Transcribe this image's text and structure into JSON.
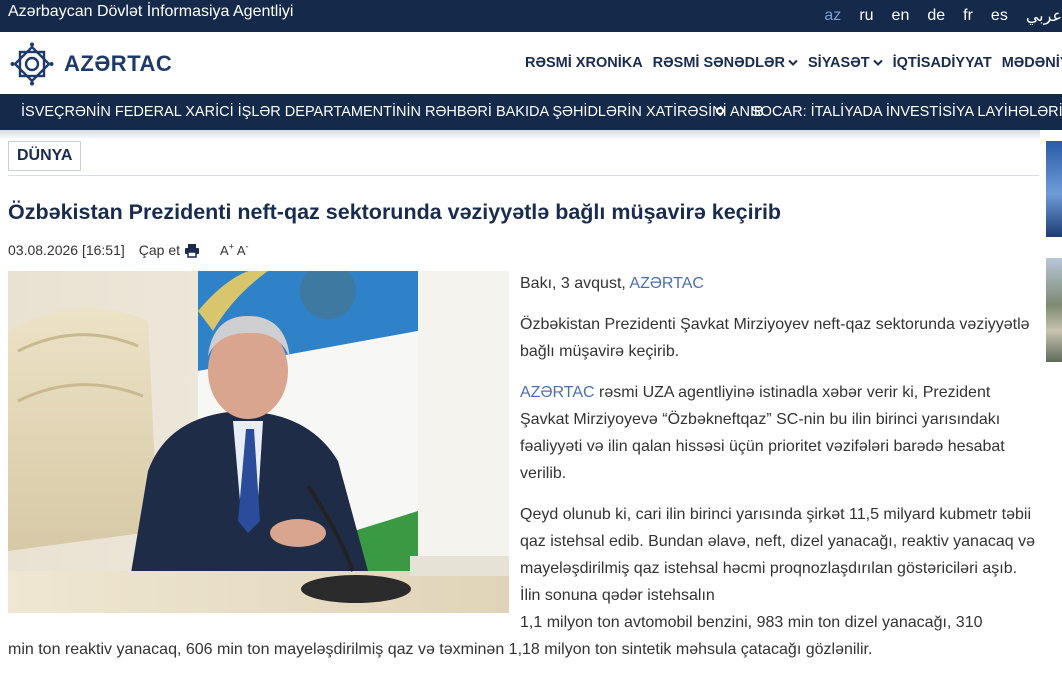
{
  "topbar": {
    "agency": "Azərbaycan Dövlət İnformasiya Agentliyi",
    "languages": [
      "az",
      "ru",
      "en",
      "de",
      "fr",
      "es",
      "عربي"
    ],
    "active_language": "az"
  },
  "header": {
    "brand": "AZƏRTAC",
    "nav": [
      {
        "label": "RƏSMİ XRONİKA",
        "has_dropdown": false
      },
      {
        "label": "RƏSMİ SƏNƏDLƏR",
        "has_dropdown": true
      },
      {
        "label": "SİYASƏT",
        "has_dropdown": true
      },
      {
        "label": "İQTİSADİYYAT",
        "has_dropdown": false
      },
      {
        "label": "MƏDƏNİYYƏT",
        "has_dropdown": false
      }
    ]
  },
  "ticker": {
    "items": [
      "İSVEÇRƏNİN FEDERAL XARİCİ İŞLƏR DEPARTAMENTİNİN RƏHBƏRİ BAKIDA ŞƏHİDLƏRİN XATİRƏSİNİ ANIB",
      "SOCAR: İTALİYADA İNVESTİSİYA LAYİHƏLƏRİ VƏ A"
    ]
  },
  "article": {
    "category": "DÜNYA",
    "title": "Özbəkistan Prezidenti neft-qaz sektorunda vəziyyətlə bağlı müşavirə keçirib",
    "datetime": "03.08.2026 [16:51]",
    "print_label": "Çap et",
    "font_increase": "A",
    "font_decrease": "A",
    "dateline_prefix": "Bakı, 3 avqust, ",
    "source": "AZƏRTAC",
    "p1": "Özbəkistan Prezidenti Şavkat Mirziyoyev neft-qaz sektorunda vəziyyətlə bağlı müşavirə keçirib.",
    "p2_source": "AZƏRTAC",
    "p2_rest": " rəsmi UZA agentliyinə istinadla xəbər verir ki, Prezident Şavkat Mirziyoyevə “Özbəkneftqaz” SC-nin bu ilin birinci yarısındakı fəaliyyəti və ilin qalan hissəsi üçün prioritet vəzifələri barədə hesabat verilib.",
    "p3": "Qeyd olunub ki, cari ilin birinci yarısında şirkət 11,5 milyard kubmetr təbii qaz istehsal edib. Bundan əlavə, neft, dizel yanacağı, reaktiv yanacaq və mayeləşdirilmiş qaz istehsal həcmi proqnozlaşdırılan göstəriciləri aşıb. İlin sonuna qədər istehsalın",
    "p4_line1": "1,1 milyon ton avtomobil benzini, 983 min ton dizel yanacağı, 310",
    "p4_line2": "min ton reaktiv yanacaq, 606 min ton mayeləşdirilmiş qaz və təxminən 1,18 milyon ton sintetik məhsula çatacağı gözlənilir."
  }
}
